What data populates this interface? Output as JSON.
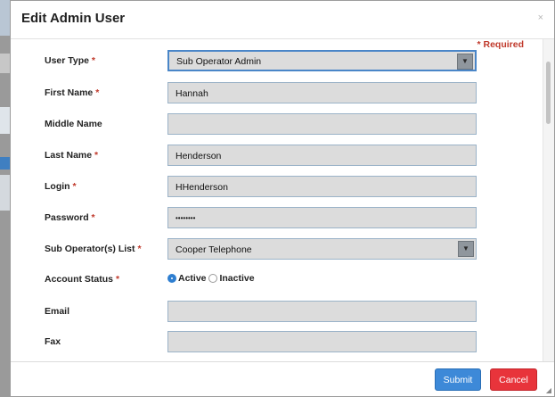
{
  "dialog": {
    "title": "Edit Admin User",
    "close_symbol": "×"
  },
  "required_note": "* Required",
  "fields": [
    {
      "label": "User Type",
      "required": true,
      "value": "Sub Operator Admin",
      "type": "select"
    },
    {
      "label": "First Name",
      "required": true,
      "value": "Hannah",
      "type": "text"
    },
    {
      "label": "Middle Name",
      "required": false,
      "value": "",
      "type": "text"
    },
    {
      "label": "Last Name",
      "required": true,
      "value": "Henderson",
      "type": "text"
    },
    {
      "label": "Login",
      "required": true,
      "value": "HHenderson",
      "type": "text"
    },
    {
      "label": "Password",
      "required": true,
      "value": "••••••••",
      "type": "password"
    },
    {
      "label": "Sub Operator(s) List",
      "required": true,
      "value": "Cooper Telephone",
      "type": "select"
    },
    {
      "label": "Account Status",
      "required": true,
      "type": "radio",
      "options": [
        {
          "label": "Active",
          "checked": true
        },
        {
          "label": "Inactive",
          "checked": false
        }
      ]
    },
    {
      "label": "Email",
      "required": false,
      "value": "",
      "type": "text"
    },
    {
      "label": "Fax",
      "required": false,
      "value": "",
      "type": "text"
    }
  ],
  "required_star": "*",
  "buttons": {
    "submit": "Submit",
    "cancel": "Cancel"
  },
  "colors": {
    "required": "#c0392b",
    "submit": "#3d89d8",
    "cancel": "#e8343b",
    "field_bg": "#dcdcdc"
  }
}
